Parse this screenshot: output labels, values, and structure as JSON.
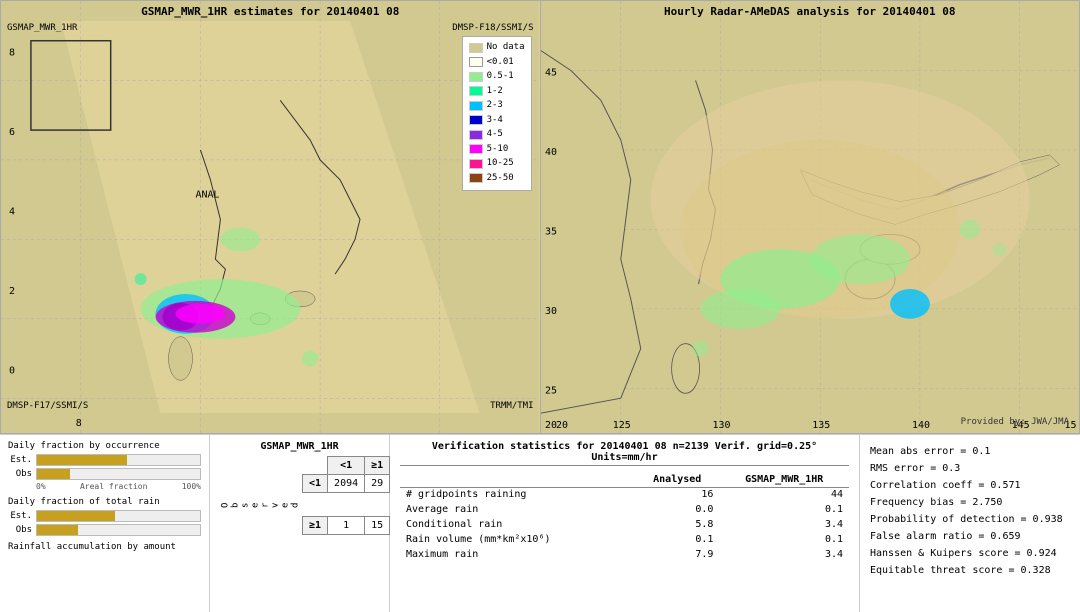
{
  "left_map": {
    "title": "GSMAP_MWR_1HR estimates for 20140401 08",
    "label_tl": "GSMAP_MWR_1HR",
    "label_tr": "DMSP-F18/SSMI/S",
    "label_bl": "DMSP-F17/SSMI/S",
    "label_br": "TRMM/TMI",
    "label_anal": "ANAL",
    "y_labels": [
      "8",
      "6",
      "4",
      "2",
      "0"
    ],
    "x_labels": [
      "8"
    ]
  },
  "right_map": {
    "title": "Hourly Radar-AMeDAS analysis for 20140401 08",
    "provided_by": "Provided by: JWA/JMA",
    "y_labels": [
      "45",
      "40",
      "35",
      "30",
      "25",
      "20"
    ],
    "x_labels": [
      "125",
      "130",
      "135",
      "140",
      "145",
      "15"
    ]
  },
  "legend": {
    "title": "",
    "items": [
      {
        "label": "No data",
        "color": "#f5f5dc"
      },
      {
        "label": "<0.01",
        "color": "#fffff0"
      },
      {
        "label": "0.5-1",
        "color": "#90ee90"
      },
      {
        "label": "1-2",
        "color": "#00fa9a"
      },
      {
        "label": "2-3",
        "color": "#00bfff"
      },
      {
        "label": "3-4",
        "color": "#0000ff"
      },
      {
        "label": "4-5",
        "color": "#8a2be2"
      },
      {
        "label": "5-10",
        "color": "#ff00ff"
      },
      {
        "label": "10-25",
        "color": "#ff1493"
      },
      {
        "label": "25-50",
        "color": "#8b4513"
      }
    ]
  },
  "bar_charts": {
    "section1_title": "Daily fraction by occurrence",
    "est_label": "Est.",
    "obs_label": "Obs",
    "est_fill_pct": 55,
    "obs_fill_pct": 20,
    "axis_left": "0%",
    "axis_middle": "Areal fraction",
    "axis_right": "100%",
    "section2_title": "Daily fraction of total rain",
    "est2_fill_pct": 48,
    "obs2_fill_pct": 25,
    "section3_title": "Rainfall accumulation by amount"
  },
  "contingency": {
    "title": "GSMAP_MWR_1HR",
    "col_lt1": "<1",
    "col_ge1": "≥1",
    "row_lt1": "<1",
    "row_ge1": "≥1",
    "obs_header": "Observed",
    "val_lt1_lt1": "2094",
    "val_lt1_ge1": "29",
    "val_ge1_lt1": "1",
    "val_ge1_ge1": "15"
  },
  "verification": {
    "title": "Verification statistics for 20140401 08  n=2139  Verif. grid=0.25°  Units=mm/hr",
    "col_analysed": "Analysed",
    "col_gsmap": "GSMAP_MWR_1HR",
    "separator": "--------------------------------------------------------------------",
    "rows": [
      {
        "label": "# gridpoints raining",
        "analysed": "16",
        "gsmap": "44"
      },
      {
        "label": "Average rain",
        "analysed": "0.0",
        "gsmap": "0.1"
      },
      {
        "label": "Conditional rain",
        "analysed": "5.8",
        "gsmap": "3.4"
      },
      {
        "label": "Rain volume (mm*km²x10⁶)",
        "analysed": "0.1",
        "gsmap": "0.1"
      },
      {
        "label": "Maximum rain",
        "analysed": "7.9",
        "gsmap": "3.4"
      }
    ]
  },
  "right_stats": {
    "lines": [
      "Mean abs error = 0.1",
      "RMS error = 0.3",
      "Correlation coeff = 0.571",
      "Frequency bias = 2.750",
      "Probability of detection = 0.938",
      "False alarm ratio = 0.659",
      "Hanssen & Kuipers score = 0.924",
      "Equitable threat score = 0.328"
    ]
  }
}
